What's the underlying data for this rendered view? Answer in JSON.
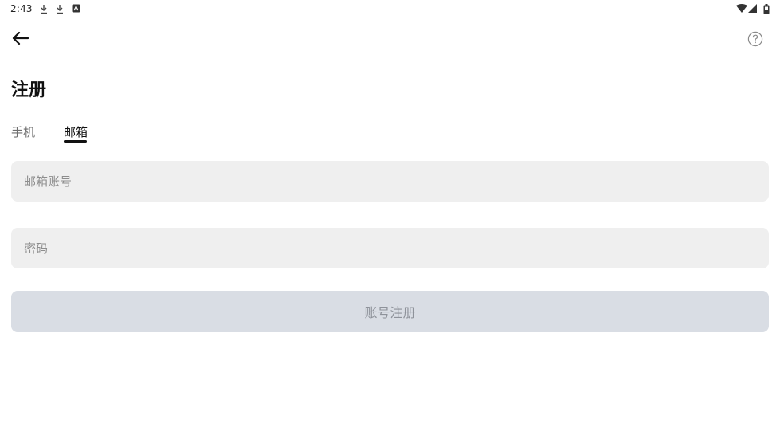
{
  "status_bar": {
    "time": "2:43",
    "notification_icons": [
      "download-icon",
      "download-icon",
      "app-badge-icon"
    ],
    "system_icons": [
      "wifi-icon",
      "signal-icon",
      "battery-icon"
    ]
  },
  "app_bar": {
    "back_icon": "arrow-left-icon",
    "help_icon": "question-circle-icon"
  },
  "page": {
    "title": "注册"
  },
  "tabs": [
    {
      "label": "手机",
      "selected": false
    },
    {
      "label": "邮箱",
      "selected": true
    }
  ],
  "form": {
    "email_placeholder": "邮箱账号",
    "email_value": "",
    "password_placeholder": "密码",
    "password_value": "",
    "submit_label": "账号注册"
  },
  "colors": {
    "field_background": "#efefef",
    "button_disabled_background": "#d9dde4",
    "button_disabled_text": "#8e929a"
  }
}
